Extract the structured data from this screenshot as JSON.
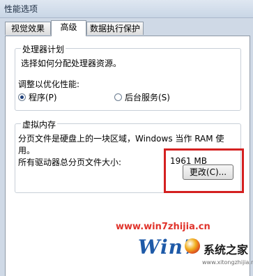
{
  "window": {
    "title": "性能选项"
  },
  "tabs": [
    {
      "label": "视觉效果",
      "active": false
    },
    {
      "label": "高级",
      "active": true
    },
    {
      "label": "数据执行保护",
      "active": false
    }
  ],
  "processor_group": {
    "legend": "处理器计划",
    "description": "选择如何分配处理器资源。",
    "adjust_label": "调整以优化性能:",
    "options": [
      {
        "label": "程序(P)",
        "selected": true
      },
      {
        "label": "后台服务(S)",
        "selected": false
      }
    ]
  },
  "virtual_memory_group": {
    "legend": "虚拟内存",
    "description_line1": "分页文件是硬盘上的一块区域，Windows 当作 RAM 使",
    "description_line2": "用。",
    "total_label": "所有驱动器总分页文件大小:",
    "total_value": "1961 MB",
    "change_button": "更改(C)..."
  },
  "watermark": {
    "url": "www.win7zhijia.cn",
    "brand": "Win7",
    "site_name": "系统之家",
    "small_url": "www.xitongzhijia.net"
  },
  "colors": {
    "highlight_box": "#d42020",
    "watermark_red": "#e0342c",
    "watermark_blue": "#1e5aa8"
  }
}
